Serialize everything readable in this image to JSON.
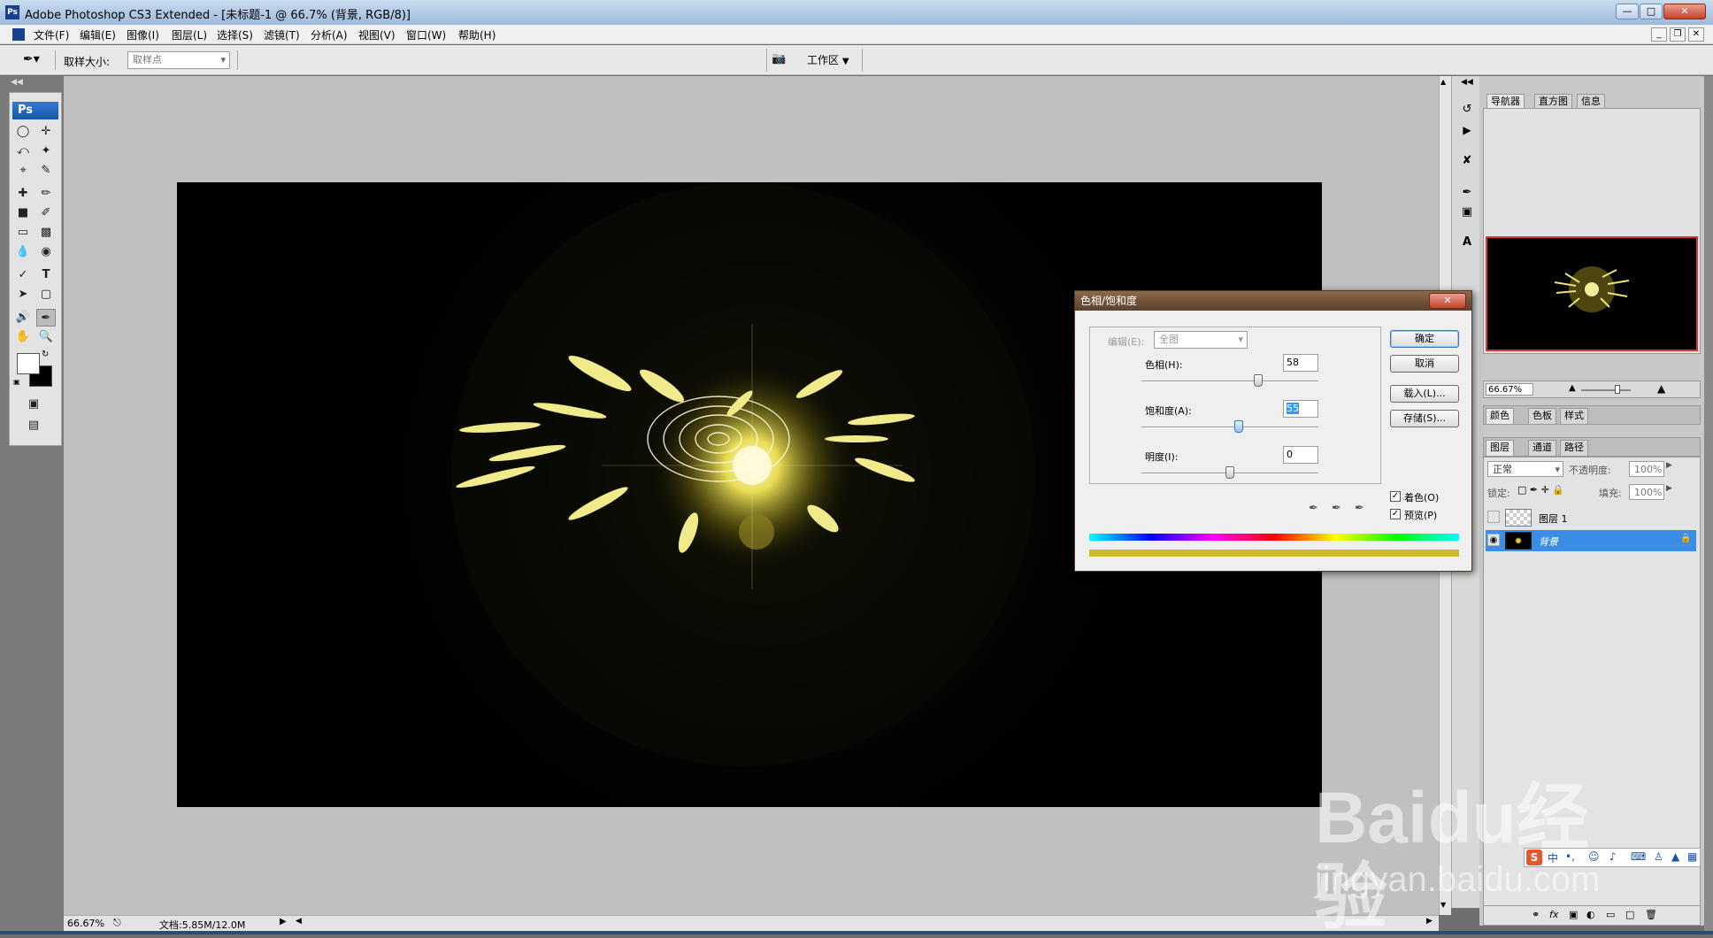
{
  "app": {
    "window_title": "Adobe Photoshop CS3 Extended - [未标题-1 @ 66.7% (背景, RGB/8)]",
    "logo": "Ps"
  },
  "menu": [
    "文件(F)",
    "编辑(E)",
    "图像(I)",
    "图层(L)",
    "选择(S)",
    "滤镜(T)",
    "分析(A)",
    "视图(V)",
    "窗口(W)",
    "帮助(H)"
  ],
  "options": {
    "sample_size_label": "取样大小:",
    "sample_size_value": "取样点",
    "workspace_label": "工作区"
  },
  "status": {
    "zoom": "66.67%",
    "doc_info": "文档:5.85M/12.0M"
  },
  "dialog": {
    "title": "色相/饱和度",
    "edit_label": "编辑(E):",
    "edit_value": "全图",
    "hue_label": "色相(H):",
    "hue_value": "58",
    "saturation_label": "饱和度(A):",
    "saturation_value": "55",
    "lightness_label": "明度(I):",
    "lightness_value": "0",
    "ok": "确定",
    "cancel": "取消",
    "load": "载入(L)...",
    "save": "存储(S)...",
    "colorize": "着色(O)",
    "preview": "预览(P)",
    "colorize_checked": true,
    "preview_checked": true,
    "hue_range": [
      -180,
      180
    ],
    "sat_range": [
      0,
      100
    ],
    "light_range": [
      -100,
      100
    ],
    "colorized_bar_color": "#cdb929"
  },
  "navigator": {
    "tabs": [
      "导航器",
      "直方图",
      "信息"
    ],
    "zoom": "66.67%"
  },
  "color_panel": {
    "tabs": [
      "颜色",
      "色板",
      "样式"
    ]
  },
  "layers_panel": {
    "tabs": [
      "图层",
      "通道",
      "路径"
    ],
    "blend_mode": "正常",
    "opacity_label": "不透明度:",
    "opacity_value": "100%",
    "lock_label": "锁定:",
    "fill_label": "填充:",
    "fill_value": "100%",
    "layers": [
      {
        "name": "图层 1",
        "visible": false,
        "selected": false
      },
      {
        "name": "背景",
        "visible": true,
        "selected": true
      }
    ]
  },
  "ime_bar": "中",
  "watermark": {
    "brand": "Baidu经验",
    "url": "jingyan.baidu.com"
  }
}
